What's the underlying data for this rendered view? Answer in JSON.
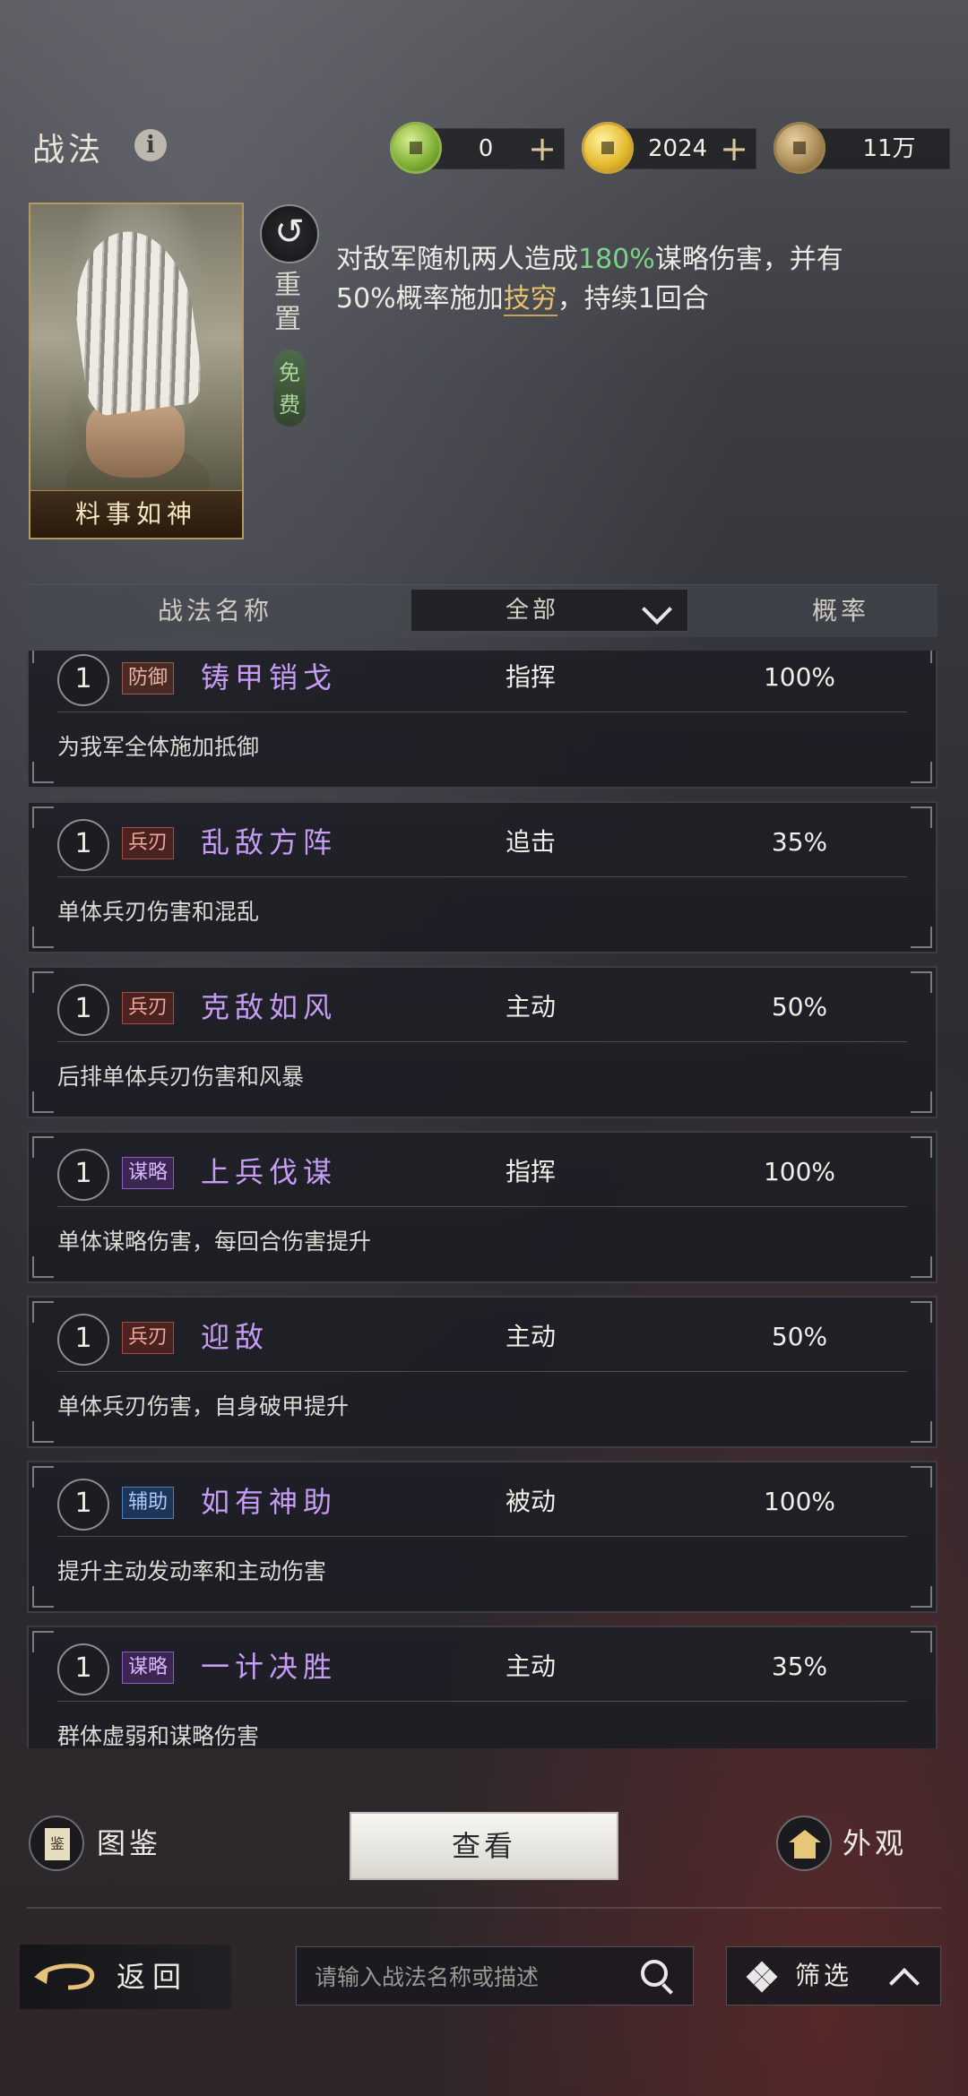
{
  "header": {
    "title": "战法",
    "resources": [
      {
        "name": "jade",
        "icon": "jade-coin-icon",
        "value": "0",
        "has_plus": true
      },
      {
        "name": "gold",
        "icon": "gold-coin-icon",
        "value": "2024",
        "has_plus": true
      },
      {
        "name": "copper",
        "icon": "copper-coin-icon",
        "value": "11万",
        "has_plus": false
      }
    ],
    "plus_symbol": "+"
  },
  "skill_card": {
    "name": "料事如神",
    "reset_label": "重置",
    "free_label": "免费",
    "description": {
      "part1": "对敌军随机两人造成",
      "highlight_percent": "180%",
      "part2": "谋略伤害，并有50%概率施加",
      "highlight_status": "技穷",
      "part3": "，持续1回合"
    }
  },
  "table_header": {
    "name_col": "战法名称",
    "filter_value": "全部",
    "rate_col": "概率"
  },
  "skills": [
    {
      "level": "1",
      "tag": "防御",
      "name": "铸甲销戈",
      "type": "指挥",
      "rate": "100%",
      "desc": "为我军全体施加抵御"
    },
    {
      "level": "1",
      "tag": "兵刃",
      "name": "乱敌方阵",
      "type": "追击",
      "rate": "35%",
      "desc": "单体兵刃伤害和混乱"
    },
    {
      "level": "1",
      "tag": "兵刃",
      "name": "克敌如风",
      "type": "主动",
      "rate": "50%",
      "desc": "后排单体兵刃伤害和风暴"
    },
    {
      "level": "1",
      "tag": "谋略",
      "name": "上兵伐谋",
      "type": "指挥",
      "rate": "100%",
      "desc": "单体谋略伤害，每回合伤害提升"
    },
    {
      "level": "1",
      "tag": "兵刃",
      "name": "迎敌",
      "type": "主动",
      "rate": "50%",
      "desc": "单体兵刃伤害，自身破甲提升"
    },
    {
      "level": "1",
      "tag": "辅助",
      "name": "如有神助",
      "type": "被动",
      "rate": "100%",
      "desc": "提升主动发动率和主动伤害"
    },
    {
      "level": "1",
      "tag": "谋略",
      "name": "一计决胜",
      "type": "主动",
      "rate": "35%",
      "desc": "群体虚弱和谋略伤害"
    }
  ],
  "bottom": {
    "atlas_label": "图鉴",
    "atlas_icon_char": "鉴",
    "view_label": "查看",
    "appearance_label": "外观",
    "back_label": "返回",
    "search_placeholder": "请输入战法名称或描述",
    "filter_label": "筛选"
  }
}
